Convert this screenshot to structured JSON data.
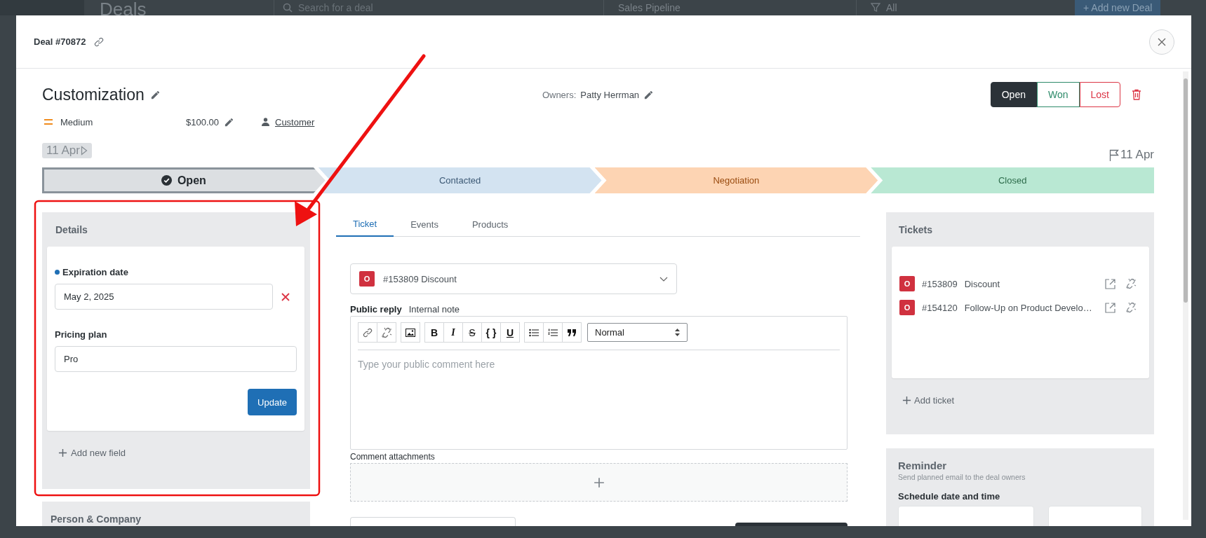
{
  "background": {
    "page_title": "Deals",
    "search_placeholder": "Search for a deal",
    "pipeline": "Sales Pipeline",
    "filter": "All",
    "add_button": "+ Add new Deal"
  },
  "modal": {
    "title": "Deal #70872"
  },
  "deal": {
    "name": "Customization",
    "owners_label": "Owners:",
    "owner": "Patty Herrman",
    "priority": "Medium",
    "amount": "$100.00",
    "contact": "Customer",
    "start_date": "11 Apr",
    "due_date": "11 Apr",
    "status_buttons": [
      {
        "label": "Open",
        "kind": "open",
        "selected": true
      },
      {
        "label": "Won",
        "kind": "won",
        "selected": false
      },
      {
        "label": "Lost",
        "kind": "lost",
        "selected": false
      }
    ]
  },
  "stages": [
    {
      "label": "Open",
      "selected": true,
      "color": "#dcdfe2"
    },
    {
      "label": "Contacted",
      "selected": false,
      "color": "#d3e3f1"
    },
    {
      "label": "Negotiation",
      "selected": false,
      "color": "#fdd4b3"
    },
    {
      "label": "Closed",
      "selected": false,
      "color": "#b9e8d3"
    }
  ],
  "details": {
    "title": "Details",
    "fields": [
      {
        "label": "Expiration date",
        "value": "May 2, 2025",
        "marked": true,
        "clearable": true
      },
      {
        "label": "Pricing plan",
        "value": "Pro",
        "marked": false,
        "clearable": false
      }
    ],
    "button": "Update",
    "add_field": "Add new field"
  },
  "person_company": {
    "title": "Person & Company"
  },
  "tabs": [
    {
      "label": "Ticket",
      "selected": true
    },
    {
      "label": "Events",
      "selected": false
    },
    {
      "label": "Products",
      "selected": false
    }
  ],
  "ticket_select": {
    "status": "O",
    "label": "#153809 Discount"
  },
  "reply_tabs": [
    {
      "label": "Public reply",
      "selected": true
    },
    {
      "label": "Internal note",
      "selected": false
    }
  ],
  "editor": {
    "format_buttons": [
      "B",
      "I",
      "S",
      "{ }",
      "U"
    ],
    "format": "Normal",
    "placeholder": "Type your public comment here"
  },
  "attachments": {
    "label": "Comment attachments"
  },
  "tickets": {
    "title": "Tickets",
    "items": [
      {
        "status": "O",
        "number": "#153809",
        "subject": "Discount"
      },
      {
        "status": "O",
        "number": "#154120",
        "subject": "Follow-Up on Product Develo…"
      }
    ],
    "add": "Add ticket"
  },
  "reminder": {
    "title": "Reminder",
    "subtitle": "Send planned email to the deal owners",
    "schedule_label": "Schedule date and time"
  }
}
